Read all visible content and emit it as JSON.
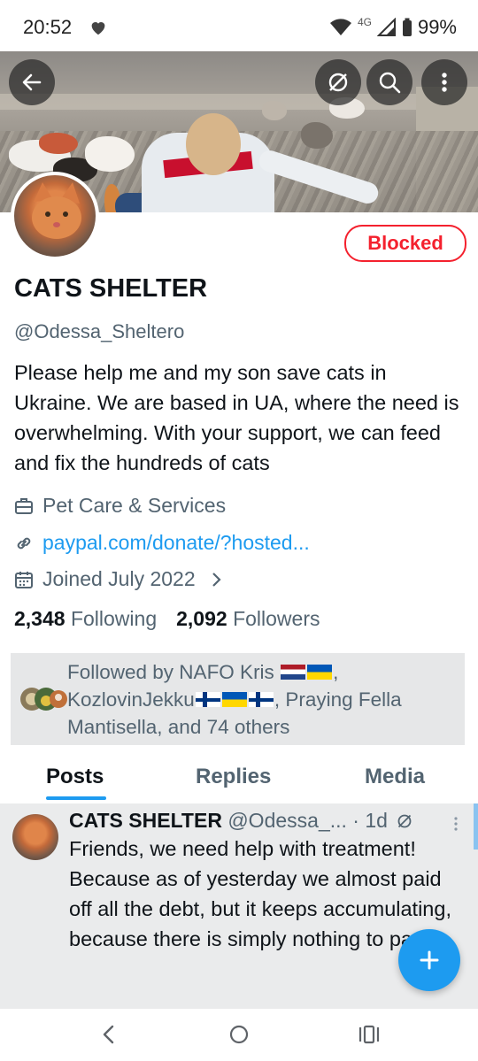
{
  "status_bar": {
    "time": "20:52",
    "network": "4G",
    "battery": "99%"
  },
  "profile": {
    "blocked_label": "Blocked",
    "name": "CATS SHELTER",
    "handle": "@Odessa_Sheltero",
    "bio": "Please help me and my son save cats in Ukraine. We are based in UA, where the need is overwhelming. With your support, we can feed and fix the hundreds of cats",
    "category": "Pet Care & Services",
    "link": "paypal.com/donate/?hosted...",
    "joined": "Joined July 2022",
    "following_count": "2,348",
    "following_label": "Following",
    "followers_count": "2,092",
    "followers_label": "Followers"
  },
  "followed_by": {
    "prefix": "Followed by NAFO Kris",
    "name2": "KozlovinJekku",
    "rest": ", Praying Fella Mantisella, and 74 others"
  },
  "tabs": [
    "Posts",
    "Replies",
    "Media"
  ],
  "post": {
    "name": "CATS SHELTER",
    "handle": "@Odessa_...",
    "time": "· 1d",
    "text": "Friends, we need help with treatment! Because as of yesterday we almost paid off all the debt, but it keeps accumulating, because there is simply nothing to pay."
  },
  "colors": {
    "accent": "#1d9bf0",
    "blocked": "#f4212e"
  },
  "icons": [
    "back-arrow-icon",
    "mute-icon",
    "search-icon",
    "more-icon",
    "briefcase-icon",
    "link-icon",
    "calendar-icon",
    "chevron-right-icon",
    "compose-plus-icon"
  ]
}
